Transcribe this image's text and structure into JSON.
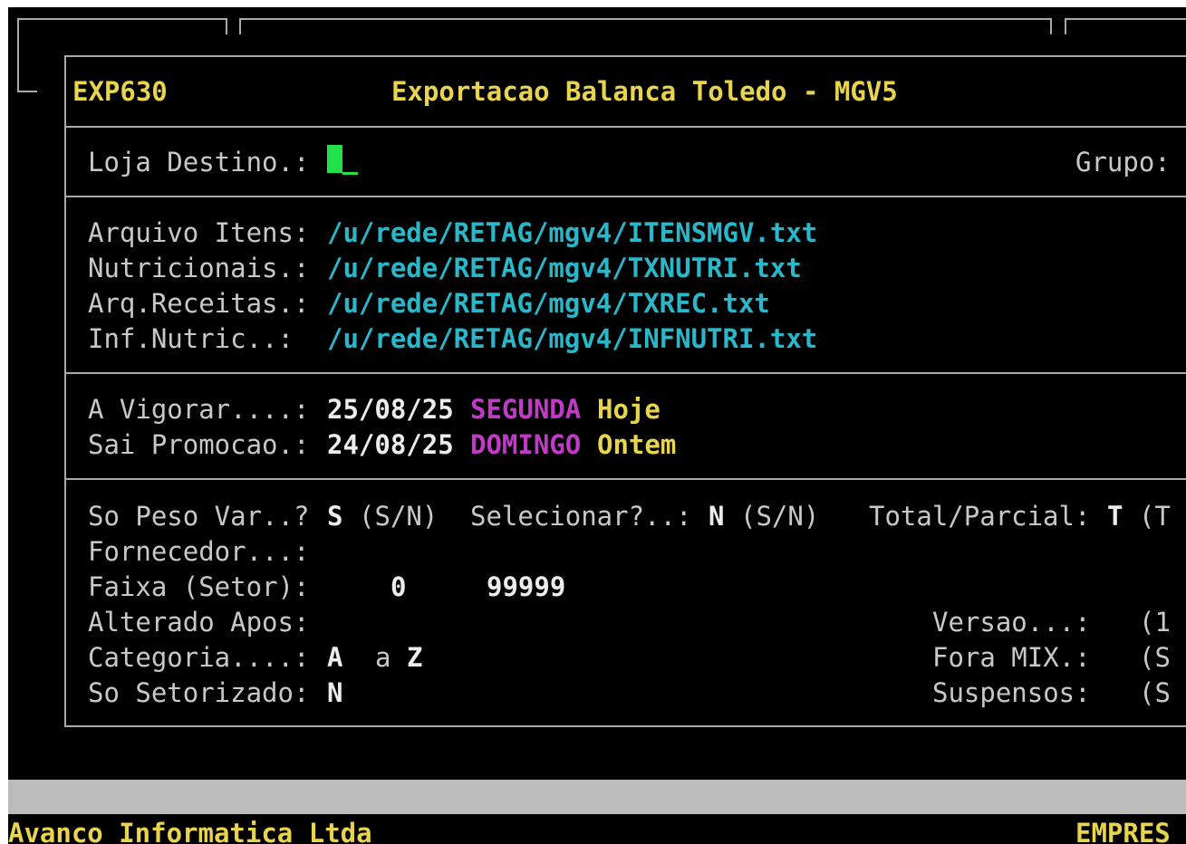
{
  "program_code": "EXP630",
  "window_title": "Exportacao Balanca Toledo - MGV5",
  "loja": {
    "label": "Loja Destino.:",
    "value": "",
    "grupo_label": "Grupo:"
  },
  "files": [
    {
      "label": "Arquivo Itens:",
      "value": "/u/rede/RETAG/mgv4/ITENSMGV.txt"
    },
    {
      "label": "Nutricionais.:",
      "value": "/u/rede/RETAG/mgv4/TXNUTRI.txt"
    },
    {
      "label": "Arq.Receitas.:",
      "value": "/u/rede/RETAG/mgv4/TXREC.txt"
    },
    {
      "label": "Inf.Nutric..:",
      "value": "/u/rede/RETAG/mgv4/INFNUTRI.txt"
    }
  ],
  "dates": {
    "vigorar": {
      "label": "A Vigorar....:",
      "date": "25/08/25",
      "weekday": "SEGUNDA",
      "relative": "Hoje"
    },
    "promocao": {
      "label": "Sai Promocao.:",
      "date": "24/08/25",
      "weekday": "DOMINGO",
      "relative": "Ontem"
    }
  },
  "options": {
    "so_peso": {
      "label": "So Peso Var..?",
      "value": "S",
      "hint": "(S/N)"
    },
    "selecionar": {
      "label": "Selecionar?..:",
      "value": "N",
      "hint": "(S/N)"
    },
    "total_parcial": {
      "label": "Total/Parcial:",
      "value": "T",
      "hint": "(T"
    },
    "fornecedor": {
      "label": "Fornecedor...:"
    },
    "faixa": {
      "label": "Faixa (Setor):",
      "from": "0",
      "to": "99999"
    },
    "alterado": {
      "label": "Alterado Apos:"
    },
    "categoria": {
      "label": "Categoria....:",
      "from": "A",
      "sep": "a",
      "to": "Z"
    },
    "setorizado": {
      "label": "So Setorizado:",
      "value": "N"
    },
    "versao": {
      "label": "Versao...:",
      "hint": "(1"
    },
    "fora_mix": {
      "label": "Fora MIX.:",
      "hint": "(S"
    },
    "suspensos": {
      "label": "Suspensos:",
      "hint": "(S"
    }
  },
  "footer": {
    "company": "Avanco Informatica Ltda",
    "right": "EMPRES"
  },
  "colors": {
    "background": "#000000",
    "label": "#c8c8c8",
    "title_yellow": "#e8d44d",
    "path_cyan": "#2ab7c9",
    "weekday_magenta": "#c13bc7",
    "cursor_green": "#22e14a",
    "status_bar": "#bcbcbc"
  }
}
